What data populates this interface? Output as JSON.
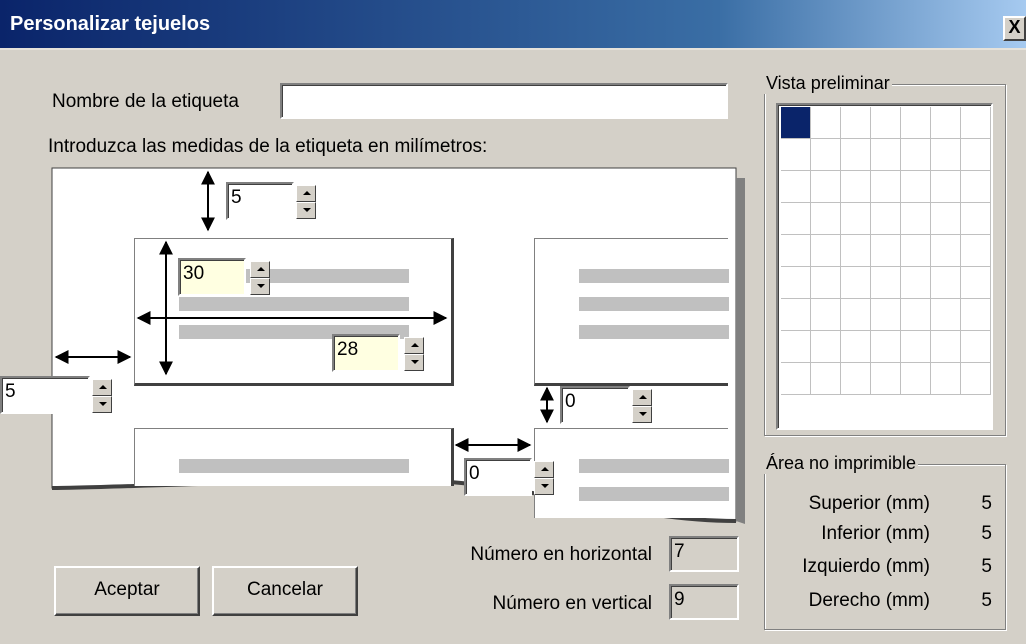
{
  "window": {
    "title": "Personalizar tejuelos",
    "close_label": "X"
  },
  "name_field": {
    "label": "Nombre de la etiqueta",
    "value": ""
  },
  "instructions": "Introduzca las medidas de la etiqueta en milímetros:",
  "measures": {
    "top_margin": "5",
    "label_height": "30",
    "label_width": "28",
    "left_margin": "5",
    "vertical_gap": "0",
    "horizontal_gap": "0"
  },
  "counts": {
    "horizontal_label": "Número en horizontal",
    "horizontal_value": "7",
    "vertical_label": "Número en vertical",
    "vertical_value": "9"
  },
  "buttons": {
    "ok": "Aceptar",
    "cancel": "Cancelar"
  },
  "preview": {
    "title": "Vista preliminar",
    "columns": 7,
    "rows": 9,
    "selected_cell": [
      1,
      1
    ]
  },
  "non_printable": {
    "title": "Área no imprimible",
    "rows": [
      {
        "label": "Superior (mm)",
        "value": "5"
      },
      {
        "label": "Inferior (mm)",
        "value": "5"
      },
      {
        "label": "Izquierdo (mm)",
        "value": "5"
      },
      {
        "label": "Derecho (mm)",
        "value": "5"
      }
    ]
  },
  "colors": {
    "title_start": "#0a246a",
    "title_end": "#a6caf0",
    "selection": "#0a246a",
    "face": "#d4d0c8",
    "input_highlight": "#ffffe1"
  }
}
